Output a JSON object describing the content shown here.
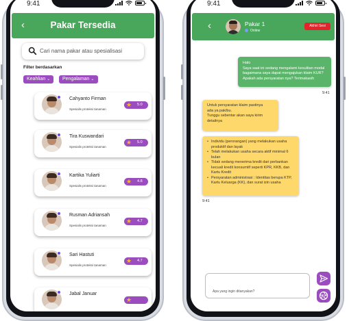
{
  "status_bar": {
    "time": "9:41"
  },
  "expert_list": {
    "title": "Pakar Tersedia",
    "search_placeholder": "Cari nama pakar atau spesialisasi",
    "filter_label": "Filter berdasarkan",
    "filters": [
      {
        "label": "Keahlian",
        "icon": "chevron-down-icon"
      },
      {
        "label": "Pengalaman",
        "icon": "chevron-down-icon"
      }
    ],
    "experts": [
      {
        "name": "Cahyanto Firman",
        "specialty": "Spesialis proteksi tanaman",
        "rating": "5.0"
      },
      {
        "name": "Tira Kuswandari",
        "specialty": "Spesialis proteksi tanaman",
        "rating": "5.0"
      },
      {
        "name": "Kartika Yuliarti",
        "specialty": "Spesialis proteksi tanaman",
        "rating": "4.8"
      },
      {
        "name": "Rusman Adriansah",
        "specialty": "Spesialis proteksi tanaman",
        "rating": "4.7"
      },
      {
        "name": "Sari Hastuti",
        "specialty": "Spesialis proteksi tanaman",
        "rating": "4.7"
      },
      {
        "name": "Jabal Januar",
        "specialty": "",
        "rating": ""
      }
    ]
  },
  "chat": {
    "expert_name": "Pakar 1",
    "status": "Online",
    "end_button": "Akhiri Sesi",
    "messages": [
      {
        "from": "user",
        "lines": [
          "Halo",
          "Saya saat ini sedang mengalami kesulitan modal",
          "bagaimana saya dapat mengajukan klaim KUR?",
          "Apakah ada persyaratan nya? Terimakasih"
        ],
        "time": "9:41"
      },
      {
        "from": "expert",
        "lines": [
          "Untuk persyaratan klaim pastinya",
          "ada ya pak/bu.",
          "Tunggu sebentar akan saya kirim",
          "detailnya"
        ]
      },
      {
        "from": "expert",
        "bullets": [
          "Individu (perorangan) yang melakukan usaha produktif dan layak",
          "Telah melakukan usaha secara aktif minimal 6 bulan",
          "Tidak sedang menerima kredit dari perbankan kecuali kredit konsumtif seperti KPR, KKB, dan Kartu Kredit",
          "Persyaratan administrasi : Identitas berupa KTP, Kartu Keluarga (KK), dan surat izin usaha"
        ],
        "time": "9:41"
      }
    ],
    "composer_placeholder": "Apa yang ingin ditanyakan?"
  },
  "colors": {
    "header_green": "#48a75a",
    "accent_purple": "#9b4dbf",
    "expert_bubble": "#ffd86b",
    "user_bubble": "#5ab46a",
    "end_red": "#e4232b"
  }
}
